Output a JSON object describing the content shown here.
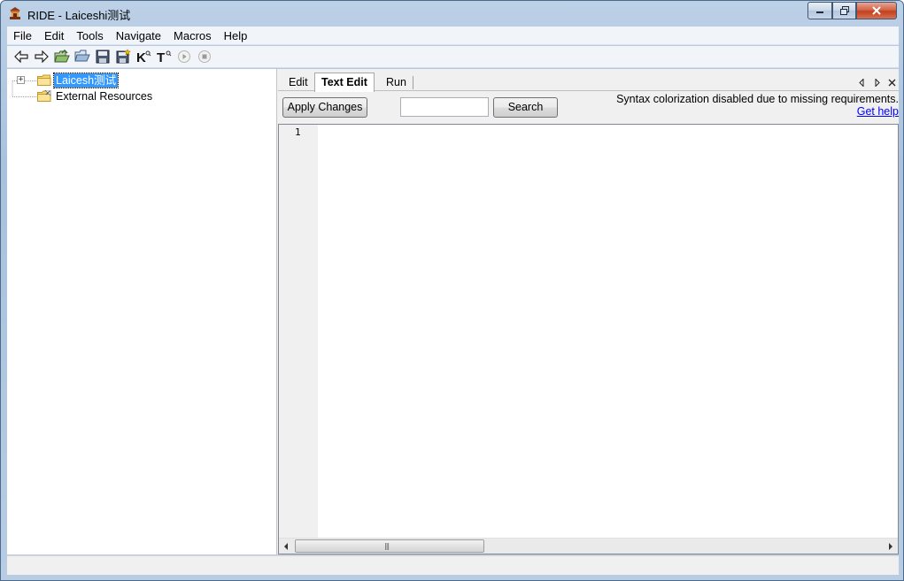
{
  "window": {
    "title": "RIDE - Laiceshi测试",
    "controls": {
      "minimize": "minimize",
      "maximize": "maximize",
      "close": "close"
    }
  },
  "menubar": {
    "items": [
      "File",
      "Edit",
      "Tools",
      "Navigate",
      "Macros",
      "Help"
    ]
  },
  "toolbar": {
    "icons": [
      "back-arrow-icon",
      "forward-arrow-icon",
      "open-suite-icon",
      "open-directory-icon",
      "save-icon",
      "save-all-icon",
      "search-keywords-icon",
      "search-tests-icon",
      "run-icon",
      "stop-icon"
    ],
    "k_glyph": "K",
    "t_glyph": "T"
  },
  "tree": {
    "root_label": "Laicesh测试",
    "expander": "+",
    "external_label": "External Resources"
  },
  "tabs": {
    "items": [
      "Edit",
      "Text Edit",
      "Run"
    ],
    "active": "Text Edit"
  },
  "text_edit": {
    "apply_label": "Apply Changes",
    "search_value": "",
    "search_label": "Search",
    "syntax_message": "Syntax colorization disabled due to missing requirements.",
    "help_link": "Get help",
    "line_numbers": [
      "1"
    ],
    "scroll_grip": "|||"
  },
  "colors": {
    "selection": "#3399ff",
    "link": "#0000ff",
    "titlebar": "#bcd0e6",
    "close_button": "#c1401f"
  }
}
